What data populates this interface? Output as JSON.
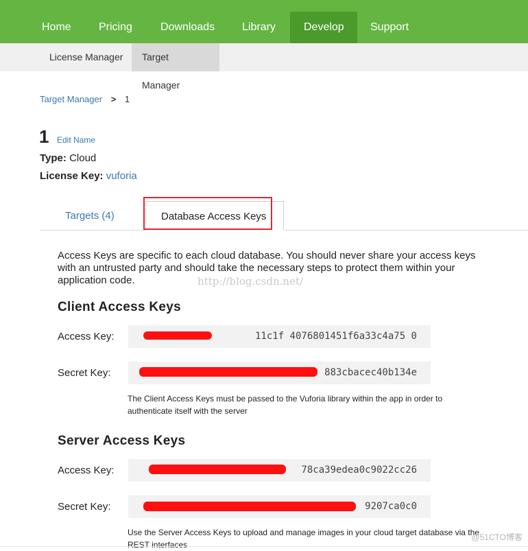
{
  "topnav": {
    "items": [
      {
        "label": "Home"
      },
      {
        "label": "Pricing"
      },
      {
        "label": "Downloads"
      },
      {
        "label": "Library"
      },
      {
        "label": "Develop",
        "active": true
      },
      {
        "label": "Support"
      }
    ],
    "bg_color": "#64b542",
    "active_bg_color": "#4a9a2c"
  },
  "subnav": {
    "items": [
      {
        "label": "License Manager"
      },
      {
        "label": "Target Manager",
        "active": true
      }
    ]
  },
  "breadcrumb": {
    "link": "Target Manager",
    "separator": ">",
    "current": "1"
  },
  "database": {
    "name": "1",
    "edit_name": "Edit Name",
    "type_label": "Type:",
    "type_value": "Cloud",
    "license_label": "License Key:",
    "license_value": "vuforia"
  },
  "tabs": [
    {
      "label": "Targets (4)"
    },
    {
      "label": "Database Access Keys",
      "active": true
    }
  ],
  "intro": "Access Keys are specific to each cloud database. You should never share your access keys with an untrusted party and should take the necessary steps to protect them within your application code.",
  "watermark": "http://blog.csdn.net/",
  "client": {
    "title": "Client Access Keys",
    "access_key_label": "Access Key:",
    "access_key_value": "11c1f   4076801451f6a33c4a75    0",
    "secret_key_label": "Secret Key:",
    "secret_key_value": "883cbacec40b134e",
    "note": "The Client Access Keys must be passed to the Vuforia library within the app in order to authenticate itself with the server"
  },
  "server": {
    "title": "Server Access Keys",
    "access_key_label": "Access Key:",
    "access_key_value": "78ca39edea0c9022cc26",
    "secret_key_label": "Secret Key:",
    "secret_key_value": "9207ca0c0",
    "note": "Use the Server Access Keys to upload and manage images in your cloud target database via the REST interfaces"
  },
  "corner_watermark": "@51CTO博客",
  "colors": {
    "link": "#3a78b0",
    "redaction": "#ff1010",
    "highlight_box": "#e3262c"
  }
}
